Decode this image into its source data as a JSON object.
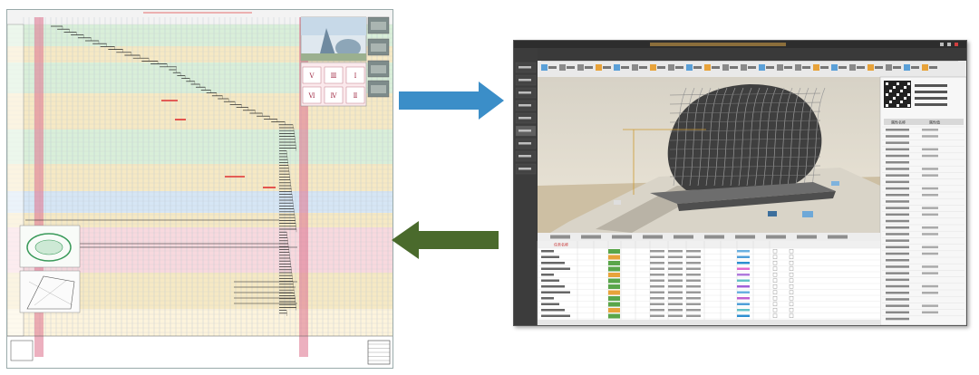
{
  "schedule_drawing": {
    "title": "",
    "gallery_labels": [
      "Ⅴ",
      "Ⅲ",
      "Ⅰ",
      "Ⅵ",
      "Ⅳ",
      "Ⅱ"
    ]
  },
  "arrows": {
    "forward_color": "#3b8ec8",
    "backward_color": "#4a6a2c"
  },
  "bim_app": {
    "window_title": "",
    "sidebar": {
      "items": [
        "",
        "",
        "",
        "",
        "",
        "",
        "",
        "",
        ""
      ]
    },
    "properties_headers": [
      "属性名称",
      "属性值"
    ],
    "gantt_headers": [
      "任务名称",
      "",
      "",
      "",
      "",
      "",
      "",
      "",
      "",
      "",
      "",
      "",
      ""
    ],
    "colors": {
      "accent": "#e8a33a",
      "selected_row": "#5aa64a",
      "dark_sidebar": "#3c3c3c"
    }
  }
}
